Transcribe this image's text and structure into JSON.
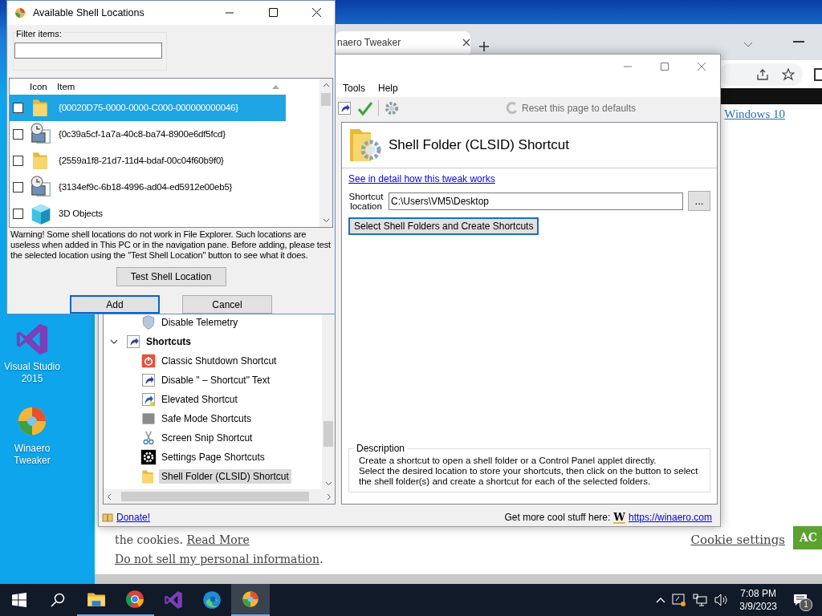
{
  "desktop_icons": [
    {
      "label": "Visual Studio 2015",
      "kind": "vs"
    },
    {
      "label": "Winaero Tweaker",
      "kind": "winaero"
    }
  ],
  "browser": {
    "tab_title": "naero Tweaker",
    "link": "Windows 10",
    "cookie_text": "the cookies.",
    "read_more": "Read More",
    "privacy_link": "Do not sell my personal information",
    "privacy_end": ".",
    "cookie_settings": "Cookie settings",
    "accept": "AC"
  },
  "tweaker": {
    "menu": [
      "Tools",
      "Help"
    ],
    "reset": {
      "label": "Reset this page to defaults",
      "disabled": true
    },
    "tree": [
      {
        "children": [
          {
            "label": "Disable Telemetry",
            "kind": "shield",
            "selected": false
          }
        ]
      },
      {
        "label": "Shortcuts",
        "kind": "shortcut",
        "expanded": true,
        "children": [
          {
            "label": "Classic Shutdown Shortcut",
            "kind": "power",
            "selected": false
          },
          {
            "label": "Disable \" – Shortcut\" Text",
            "kind": "shortcut",
            "selected": false
          },
          {
            "label": "Elevated Shortcut",
            "kind": "elevated",
            "selected": false
          },
          {
            "label": "Safe Mode Shortcuts",
            "kind": "safemode",
            "selected": false
          },
          {
            "label": "Screen Snip Shortcut",
            "kind": "scissors",
            "selected": false
          },
          {
            "label": "Settings Page Shortcuts",
            "kind": "gear",
            "selected": false
          },
          {
            "label": "Shell Folder (CLSID) Shortcut",
            "kind": "folder",
            "selected": true
          }
        ]
      }
    ],
    "page_title": "Shell Folder (CLSID) Shortcut",
    "detail_link": "See in detail how this tweak works",
    "location_label": "Shortcut location",
    "location_value": "C:\\Users\\VM5\\Desktop",
    "browse": "...",
    "action": "Select Shell Folders and Create Shortcuts",
    "description_title": "Description",
    "description": [
      "Create a shortcut to open a shell folder or a Control Panel applet directly.",
      "Select the desired location to store your shortcuts, then click on the button to select the shell folder(s) and create a shortcut for each of the selected folders."
    ],
    "status": {
      "donate": "Donate!",
      "promo": "Get more cool stuff here:",
      "logo": "W",
      "site": "https://winaero.com"
    }
  },
  "dialog": {
    "title": "Available Shell Locations",
    "filter_label": "Filter items:",
    "columns": [
      "Icon",
      "Item"
    ],
    "rows": [
      {
        "text": "{00020D75-0000-0000-C000-000000000046}",
        "kind": "folder",
        "checked": false,
        "selected": true
      },
      {
        "text": "{0c39a5cf-1a7a-40c8-ba74-8900e6df5fcd}",
        "kind": "clockdoc",
        "checked": false,
        "selected": false
      },
      {
        "text": "{2559a1f8-21d7-11d4-bdaf-00c04f60b9f0}",
        "kind": "folder",
        "checked": false,
        "selected": false
      },
      {
        "text": "{3134ef9c-6b18-4996-ad04-ed5912e00eb5}",
        "kind": "clockdoc",
        "checked": false,
        "selected": false
      },
      {
        "text": "3D Objects",
        "kind": "cube",
        "checked": false,
        "selected": false
      }
    ],
    "warning": "Warning! Some shell locations do not work in File Explorer. Such locations are useless when added in This PC or in the navigation pane. Before adding, please test the selected location using the \"Test Shell Location\" button to see what it does.",
    "test_button": "Test Shell Location",
    "buttons": [
      {
        "label": "Add",
        "default": true
      },
      {
        "label": "Cancel",
        "default": false
      }
    ]
  },
  "taskbar": {
    "apps": [
      {
        "kind": "explorer",
        "running": true,
        "active": false
      },
      {
        "kind": "chrome",
        "running": true,
        "active": false
      },
      {
        "kind": "vs",
        "running": false,
        "active": false
      },
      {
        "kind": "edge",
        "running": false,
        "active": false
      },
      {
        "kind": "winaero",
        "running": true,
        "active": true
      }
    ],
    "time": "7:08 PM",
    "date": "3/9/2023",
    "notifications": "1"
  }
}
